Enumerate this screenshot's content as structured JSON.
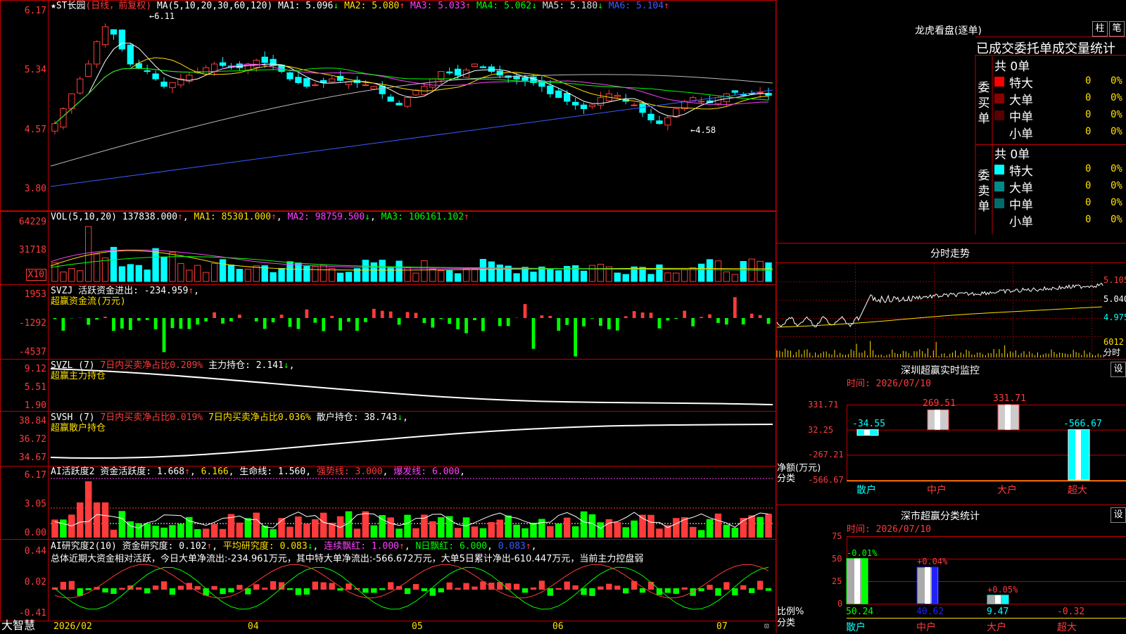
{
  "app": {
    "name": "大智慧"
  },
  "colors": {
    "up": "#ff3b3b",
    "down": "#00ffff",
    "green": "#00ff00",
    "bg": "#000000"
  },
  "main": {
    "title": "★ST长园",
    "mode": "(日线，前复权)",
    "ma_line": "MA(5,10,20,30,60,120)",
    "ma": [
      {
        "label": "MA1: 5.096",
        "arrow": "↓",
        "color": "#ffffff"
      },
      {
        "label": "MA2: 5.080",
        "arrow": "↑",
        "color": "#ffe000"
      },
      {
        "label": "MA3: 5.033",
        "arrow": "↑",
        "color": "#ff40ff"
      },
      {
        "label": "MA4: 5.062",
        "arrow": "↓",
        "color": "#00ff00"
      },
      {
        "label": "MA5: 5.180",
        "arrow": "↓",
        "color": "#dddddd"
      },
      {
        "label": "MA6: 5.104",
        "arrow": "↑",
        "color": "#3b5bff"
      }
    ],
    "y_ticks": [
      "6.17",
      "5.34",
      "4.57",
      "3.80"
    ],
    "high_label": "6.11",
    "low_label": "4.58"
  },
  "vol": {
    "header": "VOL(5,10,20)",
    "value": "137838.000",
    "value_arrow": "↑",
    "ma1": "MA1: 85301.000",
    "ma1_arrow": "↑",
    "ma2": "MA2: 98759.500",
    "ma2_arrow": "↓",
    "ma3": "MA3: 106161.102",
    "ma3_arrow": "↑",
    "y_ticks": [
      "64229",
      "31718"
    ],
    "unit": "X10"
  },
  "svzj": {
    "header": "SVZJ",
    "label": "活跃资金进出:",
    "value": "-234.959",
    "arrow": "↑",
    "sub": "超赢资金流(万元)",
    "y_ticks": [
      "1953",
      "-1292",
      "-4537"
    ]
  },
  "svzl": {
    "header": "SVZL (7)",
    "t1": "7日内买卖净占比0.209%",
    "t2": "主力持仓:",
    "v2": "2.141",
    "arrow": "↓",
    "sub": "超赢主力持仓",
    "y_ticks": [
      "9.12",
      "5.51",
      "1.90"
    ]
  },
  "svsh": {
    "header": "SVSH (7)",
    "t1": "7日内买卖净占比0.019%",
    "t2": "7日内买卖净占比0.036%",
    "t3": "散户持仓:",
    "v3": "38.743",
    "arrow": "↓",
    "sub": "超赢散户持仓",
    "y_ticks": [
      "38.84",
      "36.72",
      "34.67"
    ]
  },
  "ai1": {
    "header": "AI活跃度2",
    "t1": "资金活跃度:",
    "v1": "1.668",
    "v2": "6.166",
    "t3": "生命线:",
    "v3": "1.560",
    "t4": "强势线:",
    "v4": "3.000",
    "t5": "爆发线:",
    "v5": "6.000",
    "y_ticks": [
      "6.17",
      "3.05",
      "0.00"
    ]
  },
  "ai2": {
    "header": "AI研究度2(10)",
    "t1": "资金研究度:",
    "v1": "0.102",
    "t2": "平均研究度:",
    "v2": "0.083",
    "t3": "连续飘红:",
    "v3": "1.000",
    "t4": "N日飘红:",
    "v4": "6.000",
    "v5": "0.083",
    "desc": "总体近期大资金相对活跃，今日大单净流出:-234.961万元，其中特大单净流出:-566.672万元，大单5日累计净出-610.447万元，当前主力控盘弱",
    "y_ticks": [
      "0.44",
      "0.02",
      "-0.41"
    ]
  },
  "date_axis": [
    "2026/02",
    "04",
    "05",
    "06",
    "07"
  ],
  "right": {
    "lh_title": "龙虎看盘(逐单)",
    "btn_zhu": "柱",
    "btn_bi": "笔",
    "tabs": "已成交委托单成交量统计",
    "buy": {
      "side": "委买单",
      "total": "共 0单",
      "rows": [
        {
          "name": "特大",
          "v": "0",
          "p": "0%",
          "color": "#ff0000"
        },
        {
          "name": "大单",
          "v": "0",
          "p": "0%",
          "color": "#8b0000"
        },
        {
          "name": "中单",
          "v": "0",
          "p": "0%",
          "color": "#5a0000"
        },
        {
          "name": "小单",
          "v": "0",
          "p": "0%",
          "color": ""
        }
      ]
    },
    "sell": {
      "side": "委卖单",
      "total": "共 0单",
      "rows": [
        {
          "name": "特大",
          "v": "0",
          "p": "0%",
          "color": "#00ffff"
        },
        {
          "name": "大单",
          "v": "0",
          "p": "0%",
          "color": "#008b8b"
        },
        {
          "name": "中单",
          "v": "0",
          "p": "0%",
          "color": "#006b6b"
        },
        {
          "name": "小单",
          "v": "0",
          "p": "0%",
          "color": ""
        }
      ]
    },
    "intraday": {
      "title": "分时走势",
      "y": [
        "5.105",
        "5.040",
        "4.975"
      ],
      "vol": "6012",
      "vol_unit": "分时"
    },
    "sz_monitor": {
      "title": "深圳超赢实时监控",
      "time": "时间: 2026/07/10",
      "y": [
        "331.71",
        "32.25",
        "-267.21",
        "-566.67"
      ],
      "bars": [
        {
          "cat": "散户",
          "v": -34.55,
          "label": "-34.55"
        },
        {
          "cat": "中户",
          "v": 269.51,
          "label": "269.51"
        },
        {
          "cat": "大户",
          "v": 331.71,
          "label": "331.71"
        },
        {
          "cat": "超大",
          "v": -566.67,
          "label": "-566.67"
        }
      ],
      "axis_label": "净额(万元)",
      "cat_label": "分类",
      "set": "设"
    },
    "sz_class": {
      "title": "深市超赢分类统计",
      "time": "时间: 2026/07/10",
      "y": [
        "75",
        "50",
        "25",
        "0"
      ],
      "bars": [
        {
          "cat": "散户",
          "v": 50.24,
          "label": "50.24",
          "chg": "-0.01%"
        },
        {
          "cat": "中户",
          "v": 40.62,
          "label": "40.62",
          "chg": "+0.04%"
        },
        {
          "cat": "大户",
          "v": 9.47,
          "label": "9.47",
          "chg": "+0.05%"
        },
        {
          "cat": "超大",
          "v": -0.32,
          "label": "-0.32",
          "chg": ""
        }
      ],
      "axis_label": "比例%",
      "cat_label": "分类",
      "set": "设"
    }
  }
}
